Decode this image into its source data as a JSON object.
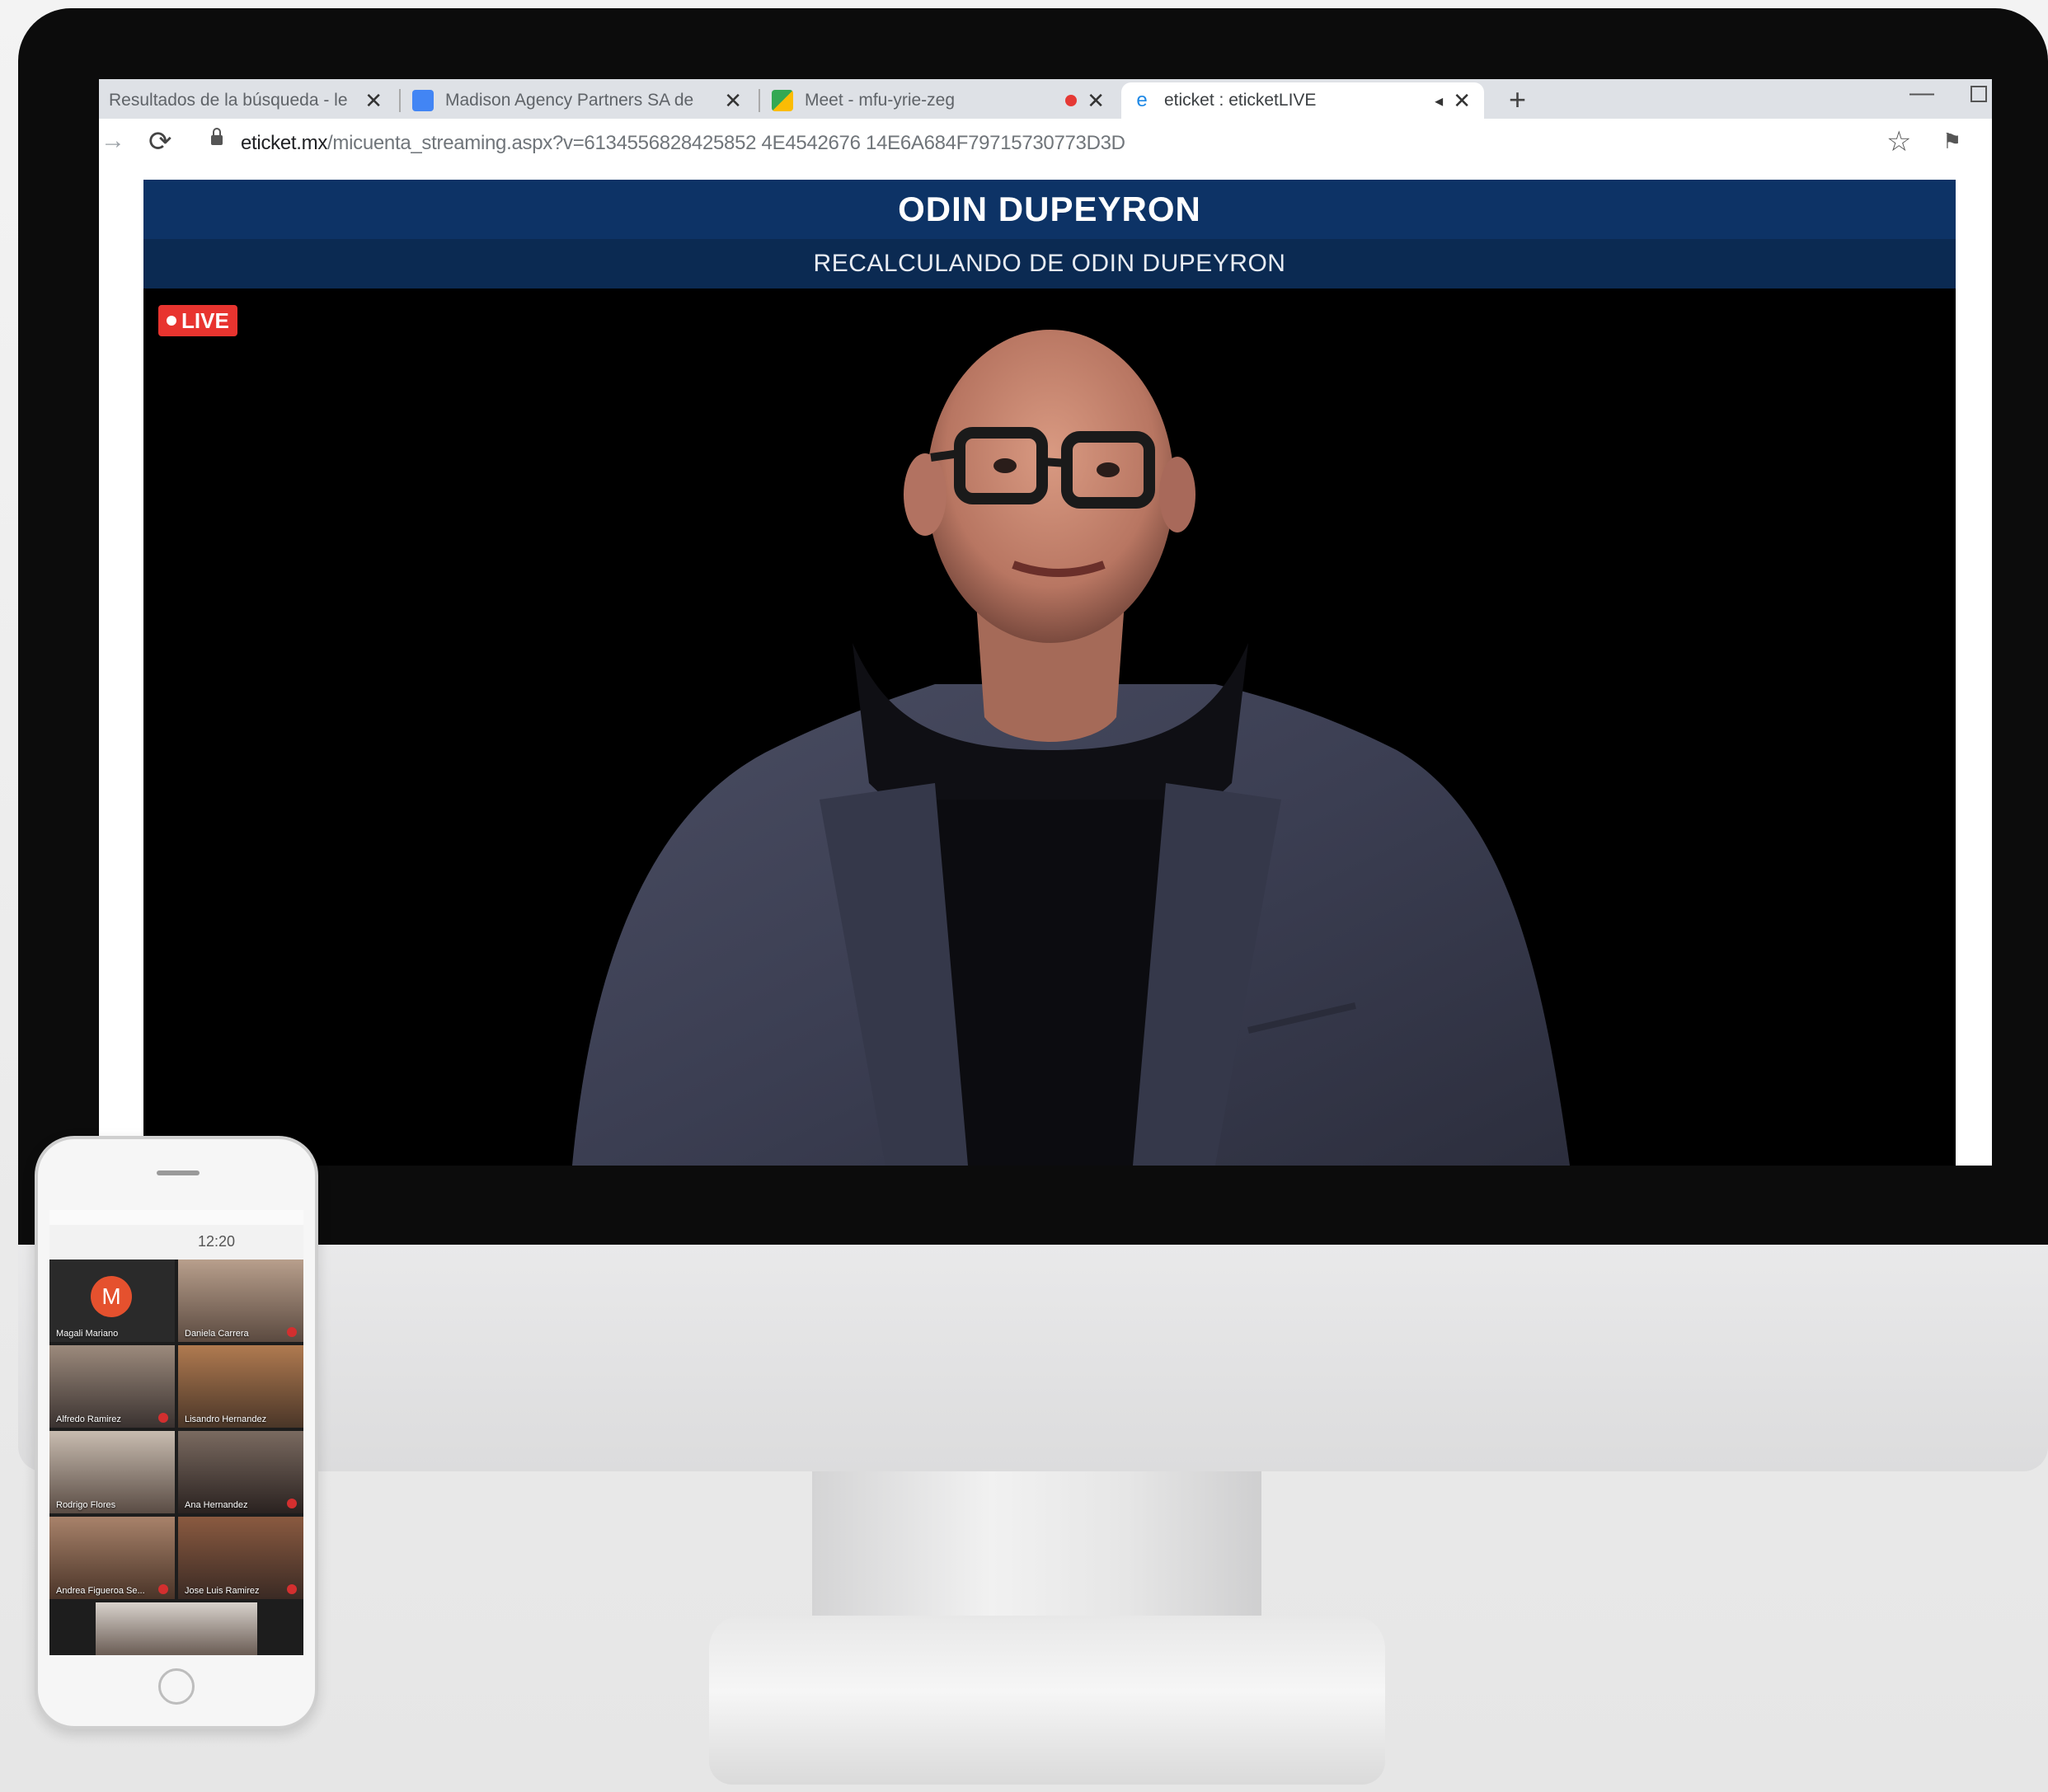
{
  "browser": {
    "tabs": [
      {
        "label": "Resultados de la búsqueda - le",
        "favicon_color": "#e0e0e0"
      },
      {
        "label": "Madison Agency Partners SA de",
        "favicon_color": "#4285f4"
      },
      {
        "label": "Meet - mfu-yrie-zeg",
        "favicon_color": "#34a853",
        "recording": true
      },
      {
        "label": "eticket : eticketLIVE",
        "favicon_color": "#1e88e5",
        "active": true
      }
    ],
    "url_host": "eticket.mx",
    "url_path": "/micuenta_streaming.aspx?v=6134556828425852 4E4542676 14E6A684F79715730773D3D"
  },
  "stream": {
    "title": "ODIN DUPEYRON",
    "subtitle": "RECALCULANDO DE ODIN DUPEYRON",
    "live_label": "LIVE"
  },
  "phone": {
    "time": "12:20",
    "participants": [
      {
        "name": "Magali Mariano",
        "avatar": "M"
      },
      {
        "name": "Daniela Carrera"
      },
      {
        "name": "Alfredo Ramirez"
      },
      {
        "name": "Lisandro Hernandez"
      },
      {
        "name": "Rodrigo Flores"
      },
      {
        "name": "Ana Hernandez"
      },
      {
        "name": "Andrea Figueroa Se..."
      },
      {
        "name": "Jose Luis Ramirez"
      }
    ]
  },
  "colors": {
    "title_bar": "#0d3366",
    "subtitle_bar": "#0b2a52",
    "live_badge": "#e8342f"
  }
}
